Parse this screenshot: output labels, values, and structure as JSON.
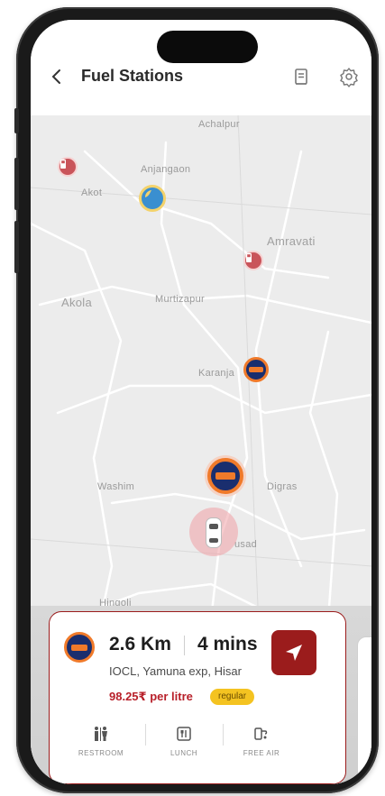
{
  "header": {
    "title": "Fuel Stations",
    "icons": [
      "back-arrow",
      "receipt-icon",
      "settings-gear-icon"
    ]
  },
  "map": {
    "places": [
      "Achalpur",
      "Anjangaon",
      "Akot",
      "Amravati",
      "Akola",
      "Murtizapur",
      "Karanja",
      "Washim",
      "Digras",
      "usad",
      "Hingoli"
    ],
    "markers": [
      "station-marker-red",
      "station-marker-blue",
      "station-marker-indianoil",
      "current-location-car"
    ]
  },
  "card": {
    "distance": "2.6 Km",
    "duration": "4 mins",
    "station": "IOCL, Yamuna exp, Hisar",
    "price": "98.25₹ per litre",
    "fuel_type": "regular",
    "amenities": [
      {
        "label": "RESTROOM",
        "icon": "restroom-icon"
      },
      {
        "label": "LUNCH",
        "icon": "lunch-icon"
      },
      {
        "label": "FREE AIR",
        "icon": "free-air-icon"
      }
    ],
    "accent": "#9b1c1c",
    "badge_color": "#f4c321"
  }
}
